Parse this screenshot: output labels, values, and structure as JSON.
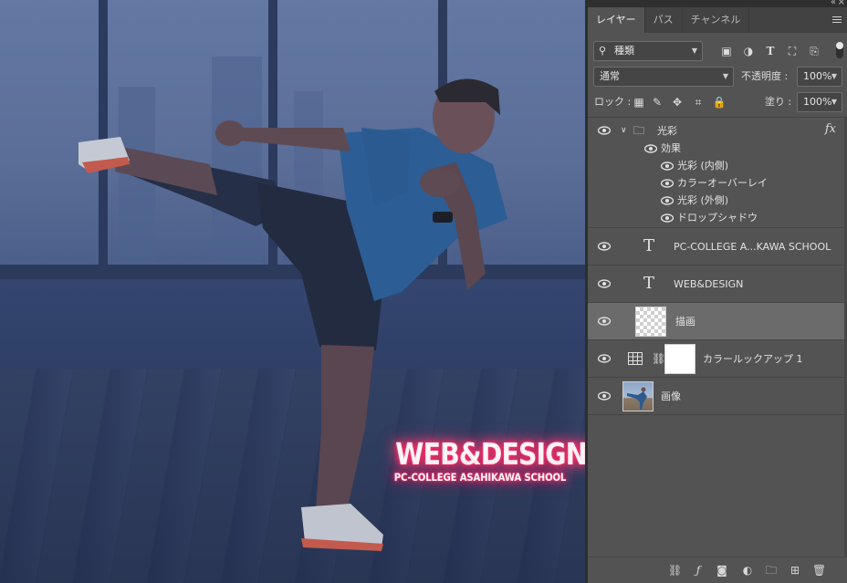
{
  "panel": {
    "tabs": [
      {
        "label": "レイヤー",
        "active": true
      },
      {
        "label": "パス",
        "active": false
      },
      {
        "label": "チャンネル",
        "active": false
      }
    ],
    "filter_value": "種類",
    "blend_mode": "通常",
    "opacity_label": "不透明度 :",
    "opacity_value": "100%",
    "lock_label": "ロック :",
    "fill_label": "塗り :",
    "fill_value": "100%"
  },
  "layers": {
    "group": {
      "name": "光彩",
      "fx": "fx",
      "effects_label": "効果",
      "effects": [
        "光彩 (内側)",
        "カラーオーバーレイ",
        "光彩 (外側)",
        "ドロップシャドウ"
      ]
    },
    "items": [
      {
        "type": "text",
        "name": "PC-COLLEGE A...KAWA SCHOOL",
        "glyph": "T"
      },
      {
        "type": "text",
        "name": "WEB&DESIGN",
        "glyph": "T"
      },
      {
        "type": "raster",
        "name": "描画",
        "selected": true
      },
      {
        "type": "adjustment",
        "name": "カラールックアップ 1"
      },
      {
        "type": "image",
        "name": "画像"
      }
    ]
  },
  "canvas": {
    "wordmark_line1": "WEB&DESIGN",
    "wordmark_line2": "PC-COLLEGE ASAHIKAWA SCHOOL",
    "glow_color": "#ff2f6e"
  },
  "colors": {
    "panel_bg": "#535353",
    "selected_row": "#6b6b6b",
    "canvas_tint": "#3b4f7e"
  }
}
